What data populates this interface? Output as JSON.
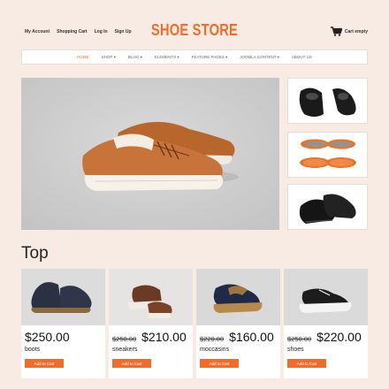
{
  "header": {
    "links": [
      "My Account",
      "Shopping Cart",
      "Log In",
      "Sign Up"
    ],
    "logo": "SHOE STORE",
    "cart_label": "Cart empty"
  },
  "nav": {
    "items": [
      "HOME",
      "SHOP ▾",
      "BLOG ▾",
      "ELEMENTS ▾",
      "FEATURE PAGES ▾",
      "JOOMLA CONTENT ▾",
      "ABOUT US"
    ],
    "active": "HOME"
  },
  "section": {
    "title": "Top"
  },
  "products": [
    {
      "name": "boots",
      "old_price": "",
      "price": "$250.00",
      "button": "Add to Cart"
    },
    {
      "name": "sneakers",
      "old_price": "$250.00",
      "price": "$210.00",
      "button": "Add to Cart"
    },
    {
      "name": "moccasins",
      "old_price": "$220.00",
      "price": "$160.00",
      "button": "Add to Cart"
    },
    {
      "name": "shoes",
      "old_price": "$250.00",
      "price": "$220.00",
      "button": "Add to Cart"
    }
  ],
  "colors": {
    "accent": "#ee6d2d",
    "background": "#f7ebe3"
  },
  "icons": {
    "cart": "shopping-cart-icon"
  }
}
